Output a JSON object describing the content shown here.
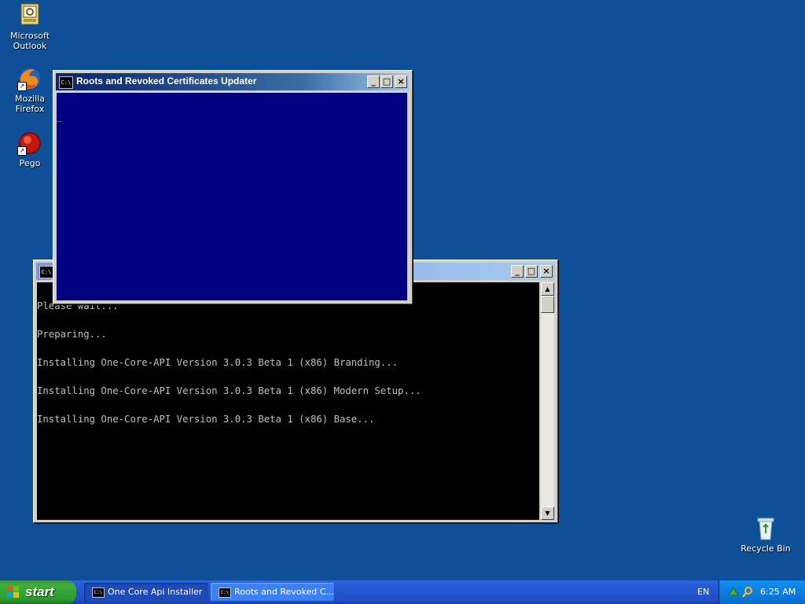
{
  "desktop": {
    "icons": [
      {
        "label_line1": "Microsoft",
        "label_line2": "Outlook",
        "icon": "outlook-icon"
      },
      {
        "label_line1": "Mozilla Firefox",
        "label_line2": "",
        "icon": "firefox-icon"
      },
      {
        "label_line1": "Pego",
        "label_line2": "",
        "icon": "pego-icon"
      },
      {
        "label_line1": "Recycle Bin",
        "label_line2": "",
        "icon": "recycle-bin-icon"
      }
    ]
  },
  "window_front": {
    "title": "Roots and Revoked Certificates Updater",
    "console_text": "_",
    "console_bg": "#000080",
    "buttons": {
      "minimize": "_",
      "maximize": "□",
      "close": "×"
    }
  },
  "window_back": {
    "title": "",
    "console_lines": [
      "Please wait...",
      "Preparing...",
      "Installing One-Core-API Version 3.0.3 Beta 1 (x86) Branding...",
      "Installing One-Core-API Version 3.0.3 Beta 1 (x86) Modern Setup...",
      "Installing One-Core-API Version 3.0.3 Beta 1 (x86) Base..."
    ],
    "console_bg": "#000000",
    "buttons": {
      "minimize": "_",
      "maximize": "□",
      "close": "×"
    }
  },
  "taskbar": {
    "start_label": "start",
    "buttons": [
      {
        "label": "One Core Api Installer",
        "state": "pressed"
      },
      {
        "label": "Roots and Revoked C...",
        "state": "normal"
      }
    ],
    "language": "EN",
    "clock": "6:25 AM"
  }
}
